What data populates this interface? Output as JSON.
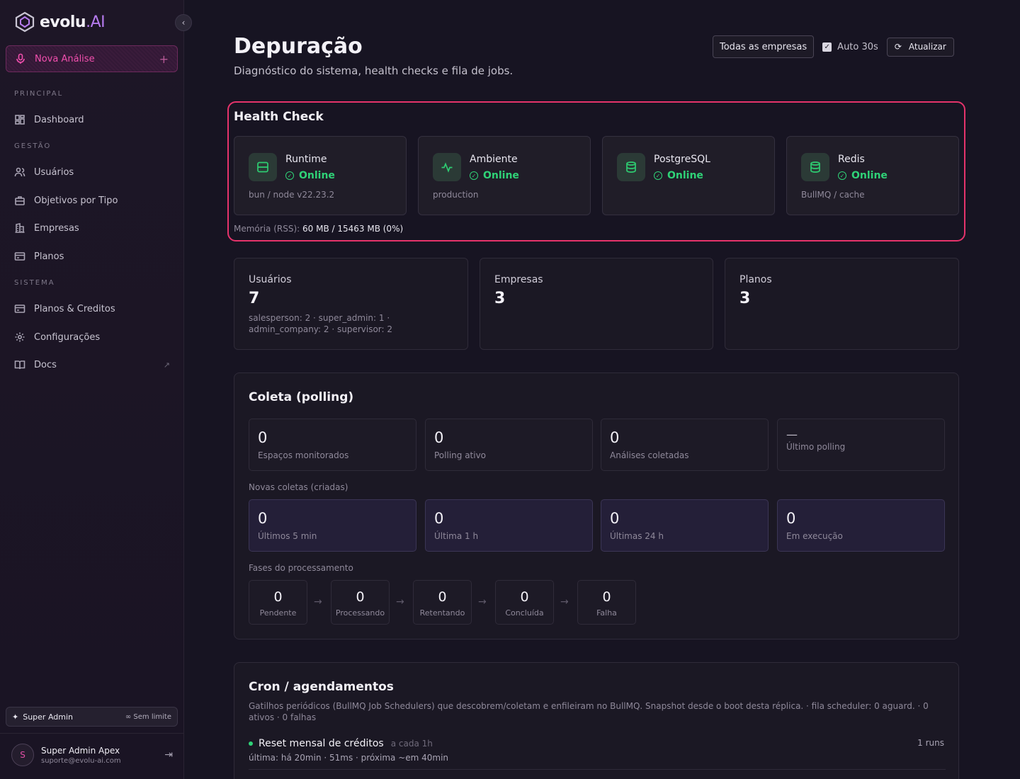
{
  "brand": {
    "name": "evolu",
    "suffix": ".AI",
    "accent": "#e5336b"
  },
  "sidebar": {
    "cta_label": "Nova Análise",
    "cta_plus": "+",
    "sections": {
      "principal": "PRINCIPAL",
      "gestao": "GESTÃO",
      "sistema": "SISTEMA"
    },
    "items": [
      {
        "label": "Dashboard",
        "icon": "dashboard-icon"
      },
      {
        "label": "Usuários",
        "icon": "users-icon"
      },
      {
        "label": "Objetivos por Tipo",
        "icon": "briefcase-icon"
      },
      {
        "label": "Empresas",
        "icon": "building-icon"
      },
      {
        "label": "Planos",
        "icon": "card-icon"
      },
      {
        "label": "Planos & Creditos",
        "icon": "card-icon"
      },
      {
        "label": "Configurações",
        "icon": "gear-icon"
      },
      {
        "label": "Docs",
        "icon": "book-icon"
      }
    ],
    "plan": {
      "role": "Super Admin",
      "limit": "∞ Sem limite"
    },
    "user": {
      "initial": "S",
      "name": "Super Admin Apex",
      "email": "suporte@evolu-ai.com"
    }
  },
  "header": {
    "title": "Depuração",
    "subtitle": "Diagnóstico do sistema, health checks e fila de jobs.",
    "company_select": "Todas as empresas",
    "auto_label": "Auto 30s",
    "auto_checked": true,
    "refresh_label": "Atualizar"
  },
  "health": {
    "title": "Health Check",
    "cards": [
      {
        "name": "Runtime",
        "status": "Online",
        "detail": "bun / node v22.23.2",
        "icon": "server-icon"
      },
      {
        "name": "Ambiente",
        "status": "Online",
        "detail": "production",
        "icon": "activity-icon"
      },
      {
        "name": "PostgreSQL",
        "status": "Online",
        "detail": "",
        "icon": "database-icon"
      },
      {
        "name": "Redis",
        "status": "Online",
        "detail": "BullMQ / cache",
        "icon": "database-icon"
      }
    ],
    "memory_label": "Memória (RSS):",
    "memory_value": "60 MB / 15463 MB (0%)"
  },
  "stats": [
    {
      "label": "Usuários",
      "value": "7",
      "detail": "salesperson: 2 · super_admin: 1 · admin_company: 2 · supervisor: 2"
    },
    {
      "label": "Empresas",
      "value": "3",
      "detail": ""
    },
    {
      "label": "Planos",
      "value": "3",
      "detail": ""
    }
  ],
  "polling": {
    "title": "Coleta (polling)",
    "metrics": [
      {
        "value": "0",
        "label": "Espaços monitorados"
      },
      {
        "value": "0",
        "label": "Polling ativo"
      },
      {
        "value": "0",
        "label": "Análises coletadas"
      },
      {
        "value": "—",
        "label": "Último polling"
      }
    ],
    "new_label": "Novas coletas (criadas)",
    "new_metrics": [
      {
        "value": "0",
        "label": "Últimos 5 min"
      },
      {
        "value": "0",
        "label": "Última 1 h"
      },
      {
        "value": "0",
        "label": "Últimas 24 h"
      },
      {
        "value": "0",
        "label": "Em execução"
      }
    ],
    "phases_label": "Fases do processamento",
    "phases": [
      {
        "value": "0",
        "label": "Pendente"
      },
      {
        "value": "0",
        "label": "Processando"
      },
      {
        "value": "0",
        "label": "Retentando"
      },
      {
        "value": "0",
        "label": "Concluída"
      },
      {
        "value": "0",
        "label": "Falha"
      }
    ],
    "arrow": "→"
  },
  "cron": {
    "title": "Cron / agendamentos",
    "description": "Gatilhos periódicos (BullMQ Job Schedulers) que descobrem/coletam e enfileiram no BullMQ. Snapshot desde o boot desta réplica. · fila scheduler: 0 aguard. · 0 ativos · 0 falhas",
    "items": [
      {
        "name": "Reset mensal de créditos",
        "freq": "a cada 1h",
        "runs": "1 runs",
        "last": "última: há 20min · 51ms · próxima ~em 40min"
      }
    ]
  }
}
